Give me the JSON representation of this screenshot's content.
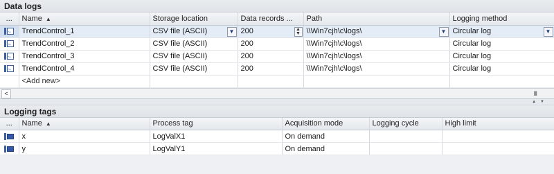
{
  "data_logs": {
    "title": "Data logs",
    "columns": [
      "...",
      "Name",
      "Storage location",
      "Data records ...",
      "Path",
      "Logging method"
    ],
    "rows": [
      {
        "name": "TrendControl_1",
        "storage": "CSV file (ASCII)",
        "records": "200",
        "path": "\\\\Win7cjh\\c\\logs\\",
        "method": "Circular log"
      },
      {
        "name": "TrendControl_2",
        "storage": "CSV file (ASCII)",
        "records": "200",
        "path": "\\\\Win7cjh\\c\\logs\\",
        "method": "Circular log"
      },
      {
        "name": "TrendControl_3",
        "storage": "CSV file (ASCII)",
        "records": "200",
        "path": "\\\\Win7cjh\\c\\logs\\",
        "method": "Circular log"
      },
      {
        "name": "TrendControl_4",
        "storage": "CSV file (ASCII)",
        "records": "200",
        "path": "\\\\Win7cjh\\c\\logs\\",
        "method": "Circular log"
      }
    ],
    "add_new": "<Add new>",
    "selected_row": 0
  },
  "scrollbar": {
    "left_arrow": "<",
    "grip": "III"
  },
  "logging_tags": {
    "title": "Logging tags",
    "columns": [
      "...",
      "Name",
      "Process tag",
      "Acquisition mode",
      "Logging cycle",
      "High limit"
    ],
    "rows": [
      {
        "name": "x",
        "process_tag": "LogValX1",
        "mode": "On demand",
        "cycle": "",
        "high": ""
      },
      {
        "name": "y",
        "process_tag": "LogValY1",
        "mode": "On demand",
        "cycle": "",
        "high": ""
      }
    ]
  },
  "icons": {
    "log_row": "data-log-icon",
    "tag_row": "logging-tag-icon",
    "sort": "sort-ascending-icon",
    "dropdown": "chevron-down-icon"
  },
  "colors": {
    "accent": "#3b5e9c",
    "selected_row": "#e3ecf7",
    "header_bg": "#e4e8ec"
  }
}
